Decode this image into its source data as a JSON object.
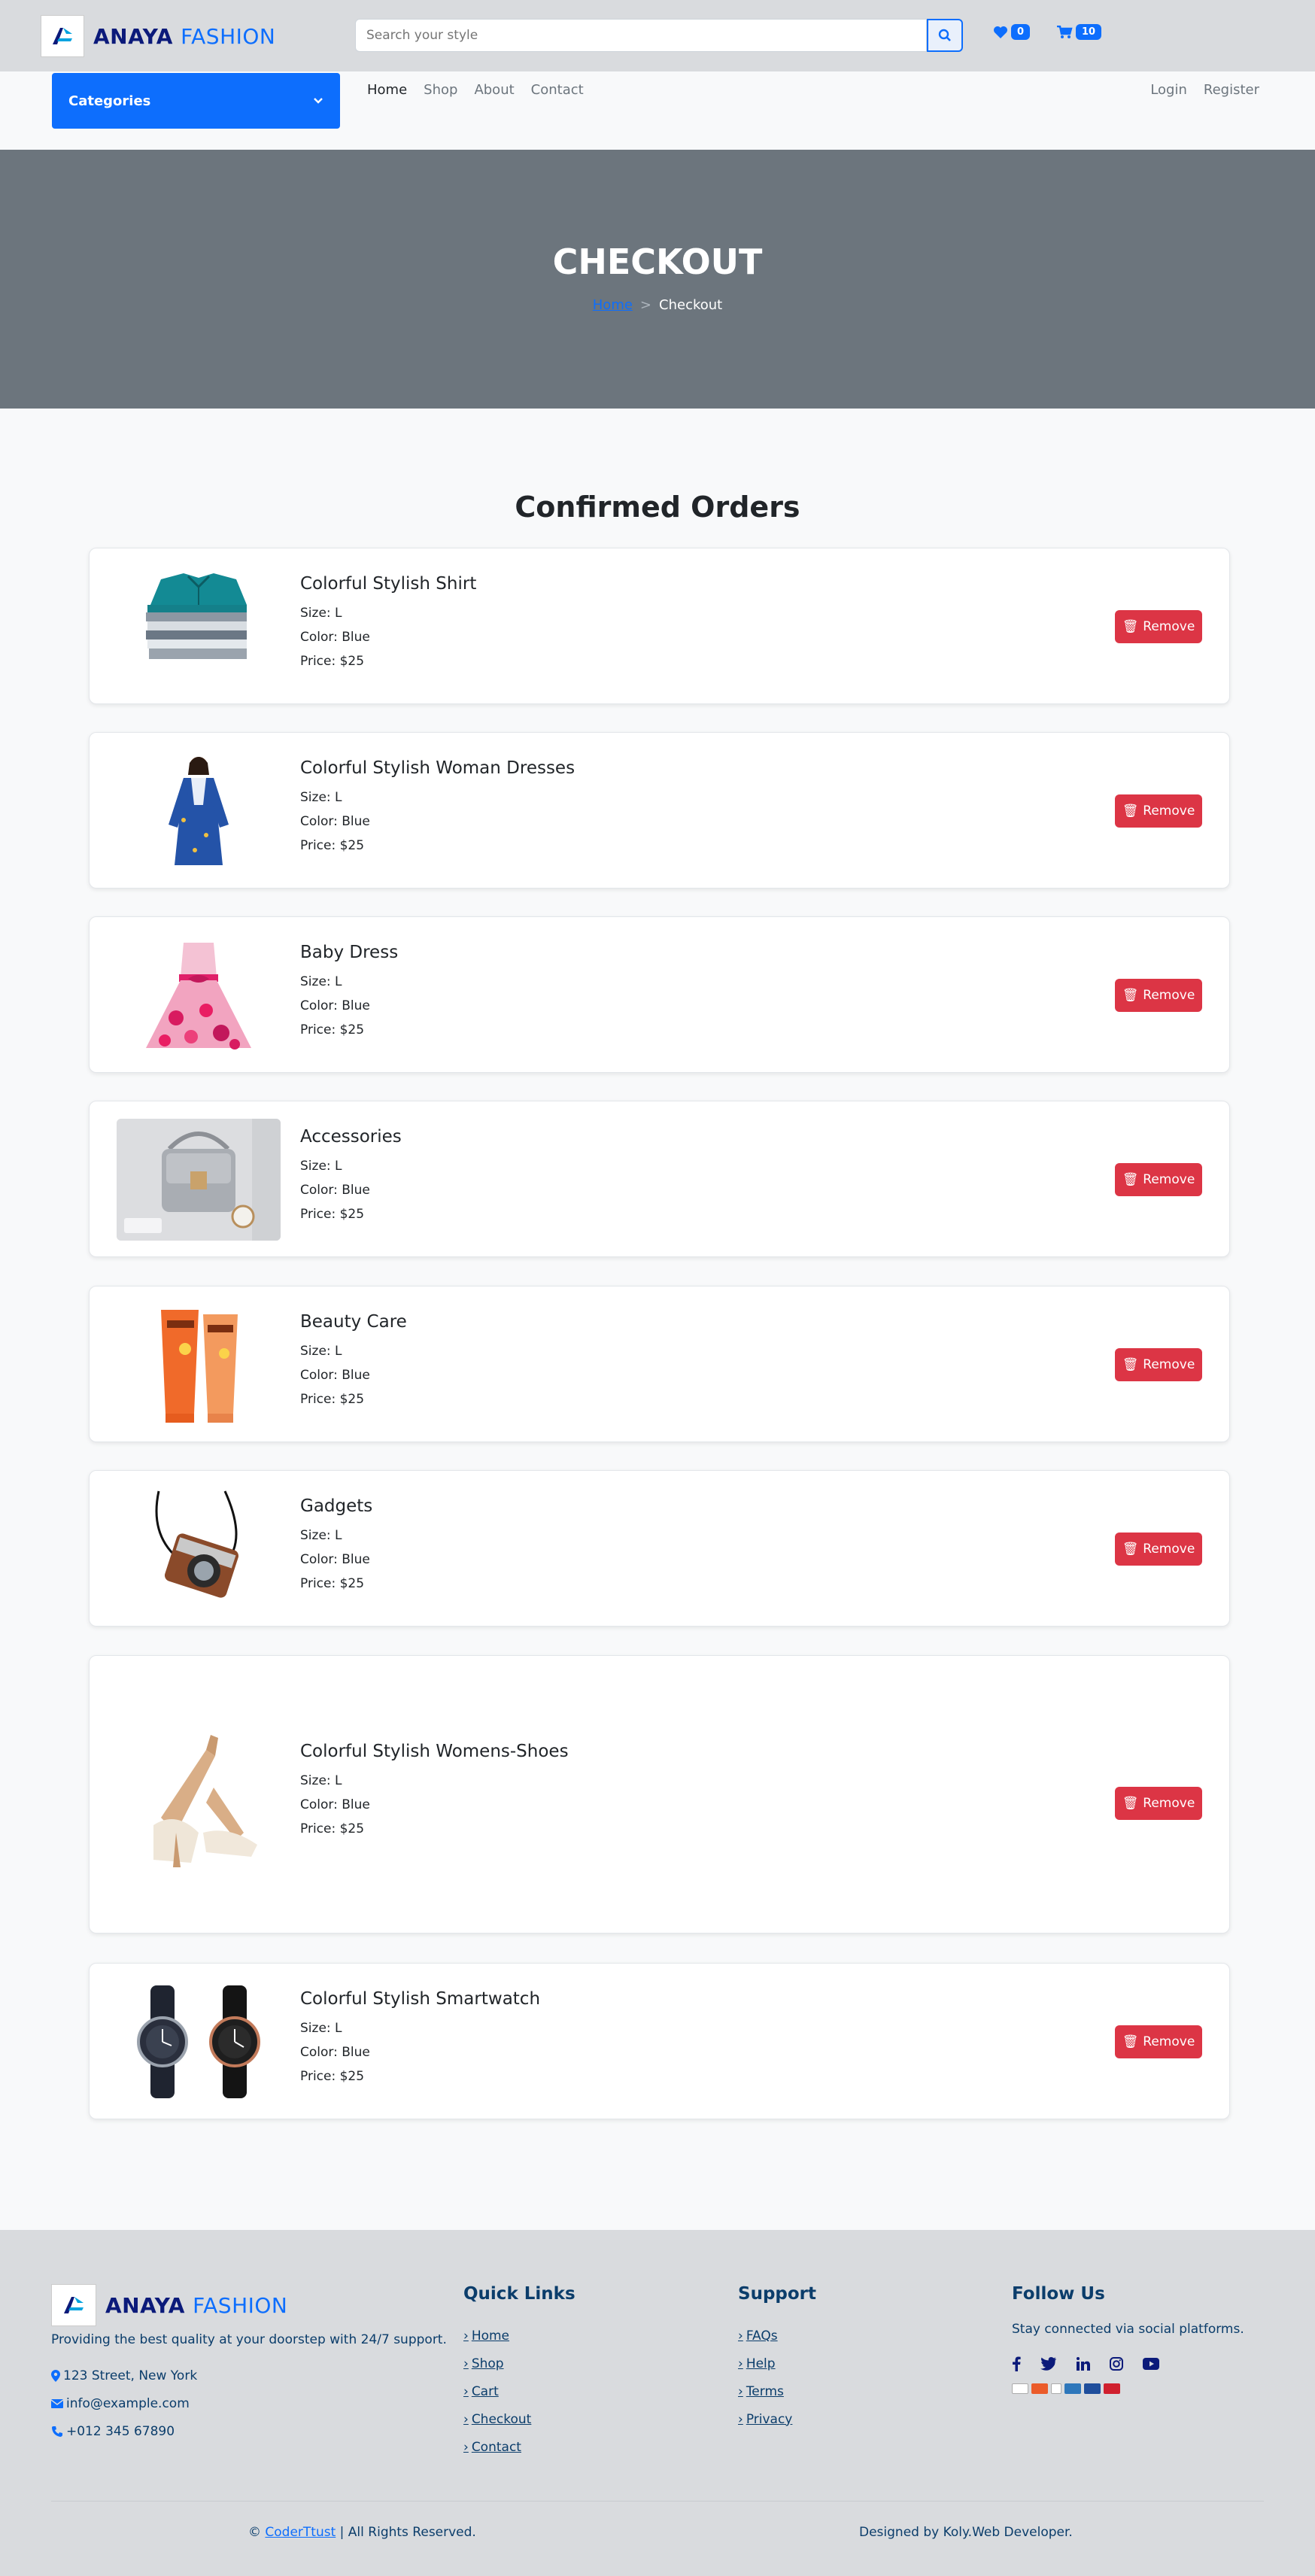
{
  "brand": {
    "name_bold": "ANAYA",
    "name_light": "FASHION"
  },
  "header": {
    "search_placeholder": "Search your style",
    "wishlist_count": "0",
    "cart_count": "10"
  },
  "nav": {
    "categories_label": "Categories",
    "links": [
      "Home",
      "Shop",
      "About",
      "Contact"
    ],
    "auth": [
      "Login",
      "Register"
    ]
  },
  "hero": {
    "title": "CHECKOUT",
    "breadcrumb_home": "Home",
    "breadcrumb_sep": ">",
    "breadcrumb_current": "Checkout"
  },
  "orders": {
    "title": "Confirmed Orders",
    "remove_label": "Remove",
    "items": [
      {
        "name": "Colorful Stylish Shirt",
        "size": "Size: L",
        "color": "Color: Blue",
        "price": "Price: $25",
        "image": "shirt-stack"
      },
      {
        "name": "Colorful Stylish Woman Dresses",
        "size": "Size: L",
        "color": "Color: Blue",
        "price": "Price: $25",
        "image": "woman-dress"
      },
      {
        "name": "Baby Dress",
        "size": "Size: L",
        "color": "Color: Blue",
        "price": "Price: $25",
        "image": "baby-dress"
      },
      {
        "name": "Accessories",
        "size": "Size: L",
        "color": "Color: Blue",
        "price": "Price: $25",
        "image": "handbag"
      },
      {
        "name": "Beauty Care",
        "size": "Size: L",
        "color": "Color: Blue",
        "price": "Price: $25",
        "image": "lotion-tubes"
      },
      {
        "name": "Gadgets",
        "size": "Size: L",
        "color": "Color: Blue",
        "price": "Price: $25",
        "image": "camera"
      },
      {
        "name": "Colorful Stylish Womens-Shoes",
        "size": "Size: L",
        "color": "Color: Blue",
        "price": "Price: $25",
        "image": "heels"
      },
      {
        "name": "Colorful Stylish Smartwatch",
        "size": "Size: L",
        "color": "Color: Blue",
        "price": "Price: $25",
        "image": "smartwatches"
      }
    ]
  },
  "footer": {
    "description": "Providing the best quality at your doorstep with 24/7 support.",
    "address": "123 Street, New York",
    "email": "info@example.com",
    "phone": "+012 345 67890",
    "quick_links_title": "Quick Links",
    "quick_links": [
      "Home",
      "Shop",
      "Cart",
      "Checkout",
      "Contact"
    ],
    "support_title": "Support",
    "support_links": [
      "FAQs",
      "Help",
      "Terms",
      "Privacy"
    ],
    "follow_title": "Follow Us",
    "follow_text": "Stay connected via social platforms.",
    "social_icons": [
      "facebook-icon",
      "twitter-icon",
      "linkedin-icon",
      "instagram-icon",
      "youtube-icon"
    ],
    "copyright_prefix": "©",
    "copyright_link": "CoderTtust",
    "copyright_suffix": "| All Rights Reserved.",
    "designed_by": "Designed by Koly.Web Developer."
  },
  "colors": {
    "primary": "#0d6efd",
    "danger": "#dc3545",
    "hero": "#6c757d",
    "footer_text": "#0b3d6b"
  }
}
